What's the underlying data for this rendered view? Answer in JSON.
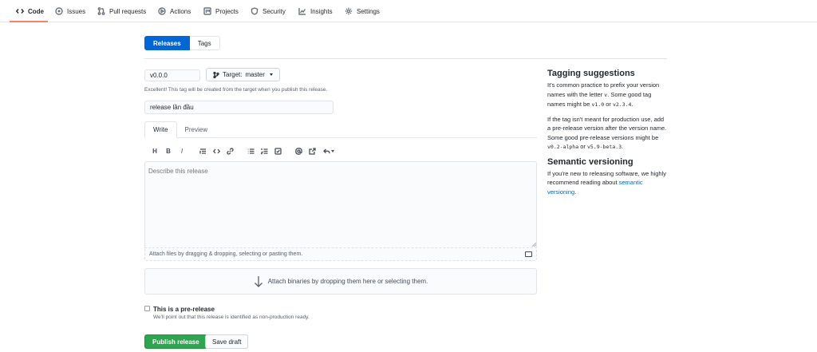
{
  "repo_nav": {
    "items": [
      {
        "label": "Code",
        "icon": "code-icon"
      },
      {
        "label": "Issues",
        "icon": "issue-icon"
      },
      {
        "label": "Pull requests",
        "icon": "pull-request-icon"
      },
      {
        "label": "Actions",
        "icon": "play-icon"
      },
      {
        "label": "Projects",
        "icon": "project-icon"
      },
      {
        "label": "Security",
        "icon": "shield-icon"
      },
      {
        "label": "Insights",
        "icon": "graph-icon"
      },
      {
        "label": "Settings",
        "icon": "gear-icon"
      }
    ],
    "active": "Code",
    "accent_color": "#f9826c"
  },
  "subnav": {
    "releases": "Releases",
    "tags": "Tags"
  },
  "form": {
    "tag_value": "v0.0.0",
    "target_label": "Target:",
    "target_branch": "master",
    "tag_hint": "Excellent! This tag will be created from the target when you publish this release.",
    "title_value": "release lần đầu",
    "tab_write": "Write",
    "tab_preview": "Preview",
    "description_placeholder": "Describe this release",
    "attach_files_text": "Attach files by dragging & dropping, selecting or pasting them.",
    "attach_binaries_text": "Attach binaries by dropping them here or selecting them.",
    "prerelease_label": "This is a pre-release",
    "prerelease_note": "We'll point out that this release is identified as non-production ready.",
    "publish_label": "Publish release",
    "draft_label": "Save draft",
    "publish_color": "#2ea44f",
    "primary_color": "#0366d6"
  },
  "toolbar": {
    "heading": "H",
    "bold": "B",
    "italic": "I"
  },
  "sidebar": {
    "tagging_title": "Tagging suggestions",
    "tagging_p1_a": "It's common practice to prefix your version names with the letter ",
    "tagging_p1_code1": "v",
    "tagging_p1_b": ". Some good tag names might be ",
    "tagging_p1_code2": "v1.0",
    "tagging_p1_c": " or ",
    "tagging_p1_code3": "v2.3.4",
    "tagging_p1_d": ".",
    "tagging_p2_a": "If the tag isn't meant for production use, add a pre-release version after the version name. Some good pre-release versions might be ",
    "tagging_p2_code1": "v0.2-alpha",
    "tagging_p2_b": " or ",
    "tagging_p2_code2": "v5.9-beta.3",
    "tagging_p2_c": ".",
    "semver_title": "Semantic versioning",
    "semver_p_a": "If you're new to releasing software, we highly recommend reading about ",
    "semver_link": "semantic versioning",
    "semver_p_b": "."
  }
}
